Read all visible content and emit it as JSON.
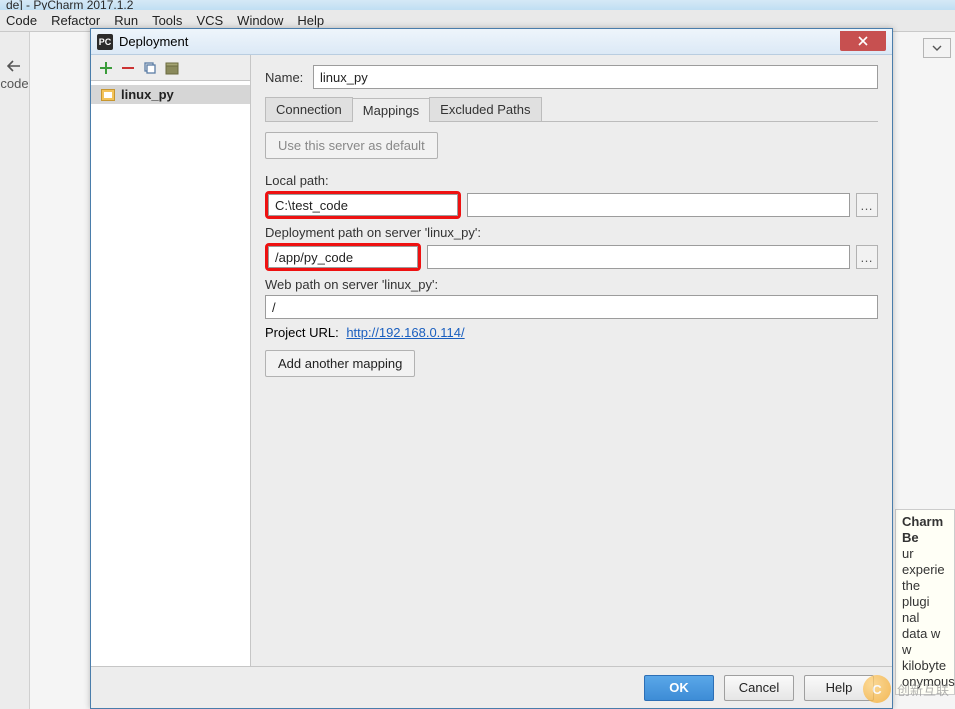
{
  "ide": {
    "title_fragment": "de] - PyCharm 2017.1.2",
    "menus": [
      "Code",
      "Refactor",
      "Run",
      "Tools",
      "VCS",
      "Window",
      "Help"
    ],
    "left_vert_label": "code"
  },
  "balloon": {
    "title": "Charm Be",
    "lines": [
      "ur experie",
      "the plugi",
      "nal data w",
      "w kilobyte",
      "onymous"
    ]
  },
  "dialog": {
    "title": "Deployment",
    "toolbar_icons": [
      "add-icon",
      "remove-icon",
      "copy-icon",
      "package-icon"
    ],
    "tree": {
      "selected": "linux_py"
    },
    "name_label": "Name:",
    "name_value": "linux_py",
    "tabs": {
      "connection": "Connection",
      "mappings": "Mappings",
      "excluded": "Excluded Paths",
      "active": "mappings"
    },
    "default_btn": "Use this server as default",
    "local_path": {
      "label": "Local path:",
      "value": "C:\\test_code"
    },
    "deploy_path": {
      "label": "Deployment path on server 'linux_py':",
      "value": "/app/py_code"
    },
    "web_path": {
      "label": "Web path on server 'linux_py':",
      "value": "/"
    },
    "project_url": {
      "label": "Project URL:",
      "value": "http://192.168.0.114/"
    },
    "add_mapping": "Add another mapping",
    "buttons": {
      "ok": "OK",
      "cancel": "Cancel",
      "help": "Help"
    }
  },
  "watermark": "创新互联"
}
